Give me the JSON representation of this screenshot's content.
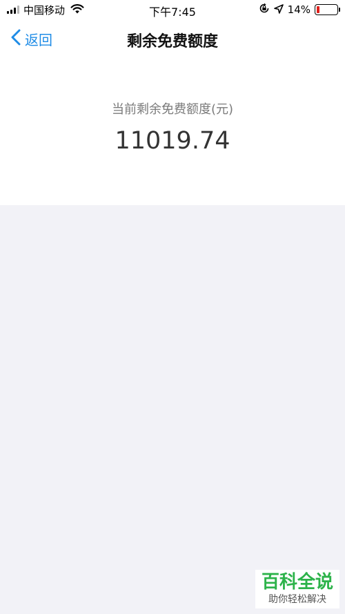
{
  "status_bar": {
    "carrier": "中国移动",
    "time": "下午7:45",
    "battery_percent": "14%",
    "battery_level": 0.14,
    "signal_bars_filled": 3,
    "signal_bars_total": 4
  },
  "nav": {
    "back_label": "返回",
    "title": "剩余免费额度"
  },
  "summary": {
    "label": "当前剩余免费额度(元)",
    "value": "11019.74"
  },
  "watermark": {
    "main": "百科全说",
    "sub": "助你轻松解决"
  },
  "colors": {
    "accent": "#1f8ce6",
    "background": "#f2f2f7",
    "battery_low": "#e0201b",
    "watermark_green": "#2db34a"
  }
}
